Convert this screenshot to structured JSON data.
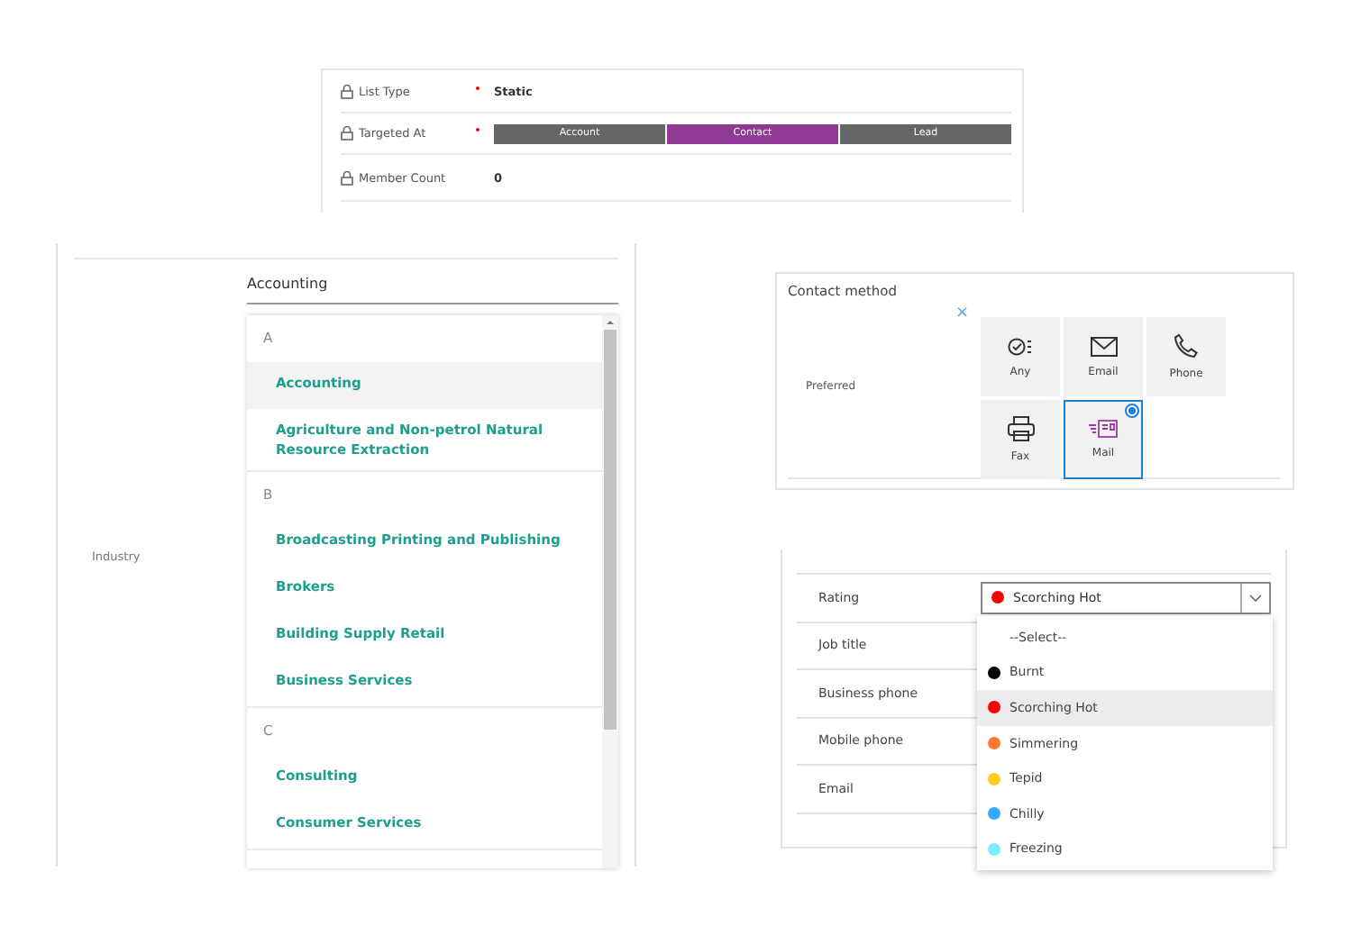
{
  "list_form": {
    "rows": [
      {
        "kind": "text",
        "label": "List Type",
        "required": true,
        "value": "Static"
      },
      {
        "kind": "segmented",
        "label": "Targeted At",
        "required": true,
        "options": [
          {
            "label": "Account",
            "selected": false
          },
          {
            "label": "Contact",
            "selected": true
          },
          {
            "label": "Lead",
            "selected": false
          }
        ]
      },
      {
        "kind": "text",
        "label": "Member Count",
        "required": false,
        "value": "0"
      }
    ]
  },
  "industry": {
    "label": "Industry",
    "value": "Accounting",
    "groups": [
      {
        "letter": "A",
        "items": [
          {
            "label": "Accounting",
            "selected": true
          },
          {
            "label": "Agriculture and Non-petrol Natural Resource Extraction",
            "selected": false
          }
        ]
      },
      {
        "letter": "B",
        "items": [
          {
            "label": "Broadcasting Printing and Publishing",
            "selected": false
          },
          {
            "label": "Brokers",
            "selected": false
          },
          {
            "label": "Building Supply Retail",
            "selected": false
          },
          {
            "label": "Business Services",
            "selected": false
          }
        ]
      },
      {
        "letter": "C",
        "items": [
          {
            "label": "Consulting",
            "selected": false
          },
          {
            "label": "Consumer Services",
            "selected": false
          }
        ]
      }
    ]
  },
  "contact_method": {
    "title": "Contact method",
    "label": "Preferred",
    "clear": "×",
    "options": [
      {
        "kind": "any",
        "label": "Any",
        "selected": false
      },
      {
        "kind": "email",
        "label": "Email",
        "selected": false
      },
      {
        "kind": "phone",
        "label": "Phone",
        "selected": false
      },
      {
        "kind": "fax",
        "label": "Fax",
        "selected": false
      },
      {
        "kind": "mail",
        "label": "Mail",
        "selected": true
      }
    ]
  },
  "lead_form": {
    "fields": [
      {
        "label": "Rating"
      },
      {
        "label": "Job title"
      },
      {
        "label": "Business phone"
      },
      {
        "label": "Mobile phone"
      },
      {
        "label": "Email"
      }
    ],
    "rating": {
      "value": "Scorching Hot",
      "color": "#ff0000",
      "options": [
        {
          "label": "--Select--",
          "selected": false
        },
        {
          "label": "Burnt",
          "color": "#000000",
          "selected": false
        },
        {
          "label": "Scorching Hot",
          "color": "#ff0000",
          "selected": true
        },
        {
          "label": "Simmering",
          "color": "#ff7733",
          "selected": false
        },
        {
          "label": "Tepid",
          "color": "#ffcc22",
          "selected": false
        },
        {
          "label": "Chilly",
          "color": "#33aaff",
          "selected": false
        },
        {
          "label": "Freezing",
          "color": "#77eeff",
          "selected": false
        }
      ]
    }
  }
}
